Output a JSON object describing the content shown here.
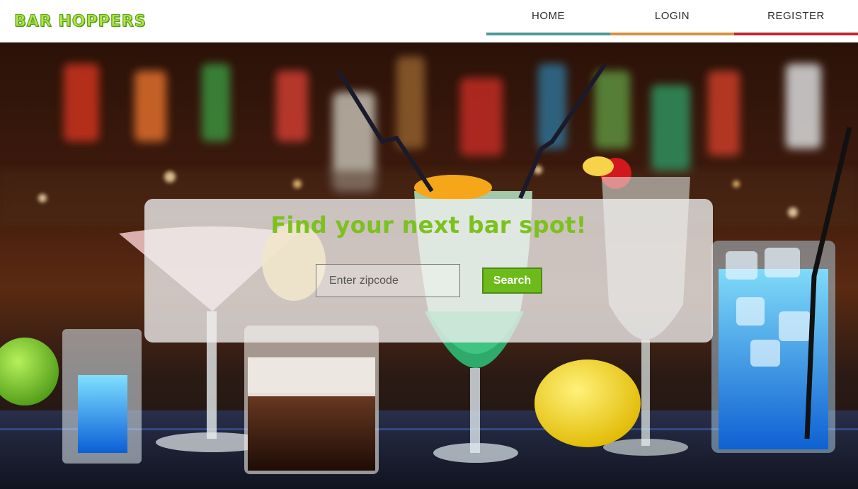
{
  "header": {
    "logo": "BAR HOPPERS",
    "nav": [
      {
        "label": "HOME",
        "color": "#4a9a92"
      },
      {
        "label": "LOGIN",
        "color": "#d6913e"
      },
      {
        "label": "REGISTER",
        "color": "#c0262e"
      }
    ]
  },
  "hero": {
    "title": "Find your next bar spot!",
    "search": {
      "placeholder": "Enter zipcode",
      "value": "",
      "button_label": "Search"
    },
    "background": "cocktail-glasses-bar-photo"
  },
  "colors": {
    "brand_green": "#7cc11e",
    "button_green": "#6cbb1a"
  }
}
